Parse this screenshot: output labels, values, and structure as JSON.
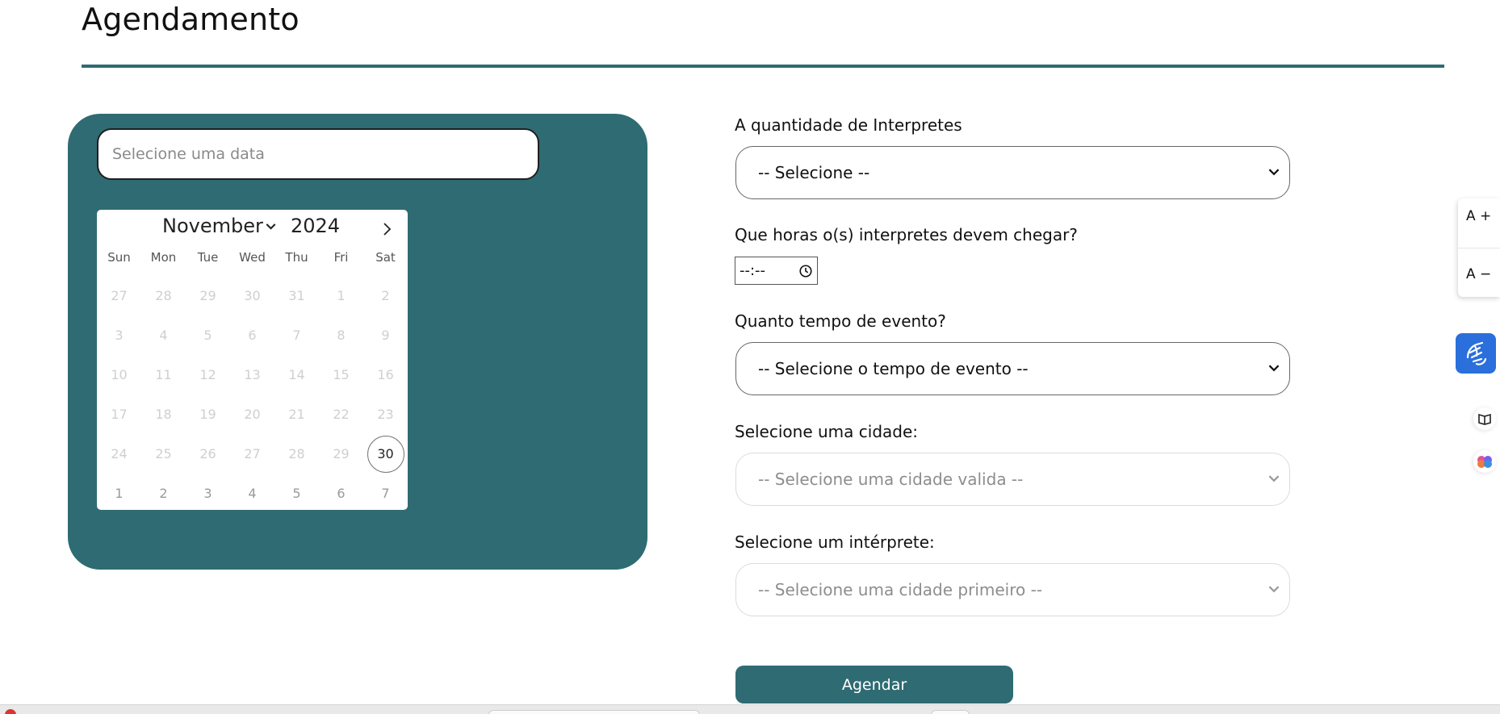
{
  "page": {
    "title": "Agendamento"
  },
  "colors": {
    "accent": "#2f6b73",
    "libras_blue": "#2a6fdb"
  },
  "date_picker": {
    "placeholder": "Selecione uma data",
    "month": "November",
    "year": "2024",
    "weekdays": [
      "Sun",
      "Mon",
      "Tue",
      "Wed",
      "Thu",
      "Fri",
      "Sat"
    ],
    "days": [
      [
        "27",
        "28",
        "29",
        "30",
        "31",
        "1",
        "2"
      ],
      [
        "3",
        "4",
        "5",
        "6",
        "7",
        "8",
        "9"
      ],
      [
        "10",
        "11",
        "12",
        "13",
        "14",
        "15",
        "16"
      ],
      [
        "17",
        "18",
        "19",
        "20",
        "21",
        "22",
        "23"
      ],
      [
        "24",
        "25",
        "26",
        "27",
        "28",
        "29",
        "30"
      ],
      [
        "1",
        "2",
        "3",
        "4",
        "5",
        "6",
        "7"
      ]
    ],
    "selected_day": "30"
  },
  "form": {
    "quantidade_label": "A quantidade de Interpretes",
    "quantidade_value": "-- Selecione --",
    "horario_label": "Que horas o(s) interpretes devem chegar?",
    "horario_value": "--:--",
    "tempo_label": "Quanto tempo de evento?",
    "tempo_value": "-- Selecione o tempo de evento --",
    "cidade_label": "Selecione uma cidade:",
    "cidade_value": "-- Selecione uma cidade valida --",
    "interprete_label": "Selecione um intérprete:",
    "interprete_value": "-- Selecione uma cidade primeiro --",
    "submit_label": "Agendar"
  },
  "accessibility": {
    "font_increase": "A +",
    "font_decrease": "A −",
    "icons": [
      "hand-sign-icon",
      "book-icon",
      "brain-icon"
    ]
  }
}
